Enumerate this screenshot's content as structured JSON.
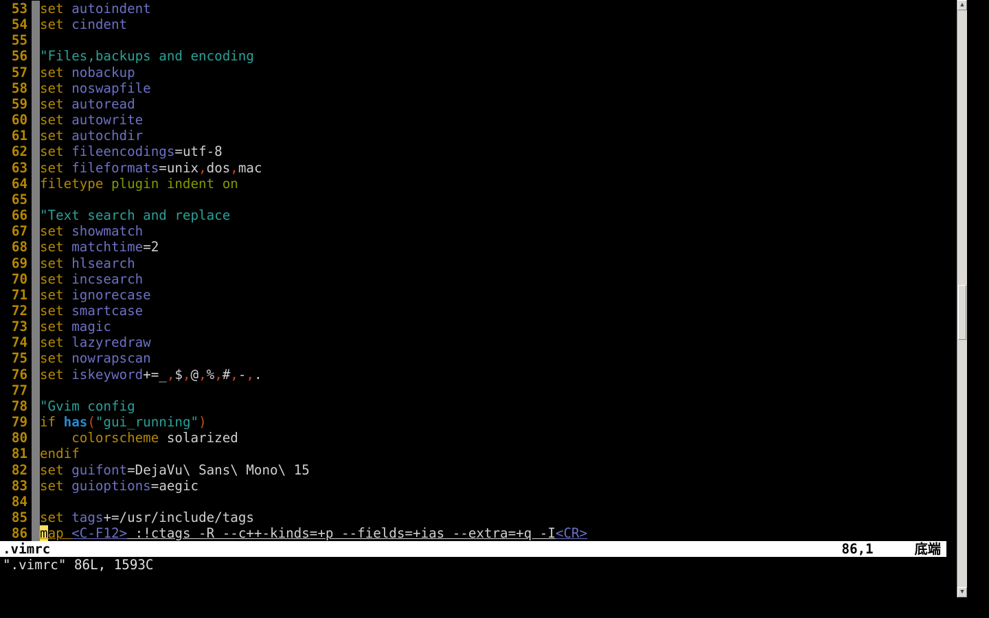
{
  "status": {
    "filename": ".vimrc",
    "position": "86,1",
    "percent": "底端"
  },
  "message": "\".vimrc\" 86L, 1593C",
  "lines": [
    {
      "n": 53,
      "t": [
        [
          "kw-set",
          "set "
        ],
        [
          "opt",
          "autoindent"
        ]
      ]
    },
    {
      "n": 54,
      "t": [
        [
          "kw-set",
          "set "
        ],
        [
          "opt",
          "cindent"
        ]
      ]
    },
    {
      "n": 55,
      "t": []
    },
    {
      "n": 56,
      "t": [
        [
          "comment",
          "\"Files,backups and encoding"
        ]
      ]
    },
    {
      "n": 57,
      "t": [
        [
          "kw-set",
          "set "
        ],
        [
          "opt",
          "nobackup"
        ]
      ]
    },
    {
      "n": 58,
      "t": [
        [
          "kw-set",
          "set "
        ],
        [
          "opt",
          "noswapfile"
        ]
      ]
    },
    {
      "n": 59,
      "t": [
        [
          "kw-set",
          "set "
        ],
        [
          "opt",
          "autoread"
        ]
      ]
    },
    {
      "n": 60,
      "t": [
        [
          "kw-set",
          "set "
        ],
        [
          "opt",
          "autowrite"
        ]
      ]
    },
    {
      "n": 61,
      "t": [
        [
          "kw-set",
          "set "
        ],
        [
          "opt",
          "autochdir"
        ]
      ]
    },
    {
      "n": 62,
      "t": [
        [
          "kw-set",
          "set "
        ],
        [
          "opt",
          "fileencodings"
        ],
        [
          "eq",
          "="
        ],
        [
          "plain",
          "utf-8"
        ]
      ]
    },
    {
      "n": 63,
      "t": [
        [
          "kw-set",
          "set "
        ],
        [
          "opt",
          "fileformats"
        ],
        [
          "eq",
          "="
        ],
        [
          "plain",
          "unix"
        ],
        [
          "punct",
          ","
        ],
        [
          "plain",
          "dos"
        ],
        [
          "punct",
          ","
        ],
        [
          "plain",
          "mac"
        ]
      ]
    },
    {
      "n": 64,
      "t": [
        [
          "kw-yellow",
          "filetype "
        ],
        [
          "ident-green",
          "plugin indent on"
        ]
      ]
    },
    {
      "n": 65,
      "t": []
    },
    {
      "n": 66,
      "t": [
        [
          "comment",
          "\"Text search and replace"
        ]
      ]
    },
    {
      "n": 67,
      "t": [
        [
          "kw-set",
          "set "
        ],
        [
          "opt",
          "showmatch"
        ]
      ]
    },
    {
      "n": 68,
      "t": [
        [
          "kw-set",
          "set "
        ],
        [
          "opt",
          "matchtime"
        ],
        [
          "eq",
          "="
        ],
        [
          "plain",
          "2"
        ]
      ]
    },
    {
      "n": 69,
      "t": [
        [
          "kw-set",
          "set "
        ],
        [
          "opt",
          "hlsearch"
        ]
      ]
    },
    {
      "n": 70,
      "t": [
        [
          "kw-set",
          "set "
        ],
        [
          "opt",
          "incsearch"
        ]
      ]
    },
    {
      "n": 71,
      "t": [
        [
          "kw-set",
          "set "
        ],
        [
          "opt",
          "ignorecase"
        ]
      ]
    },
    {
      "n": 72,
      "t": [
        [
          "kw-set",
          "set "
        ],
        [
          "opt",
          "smartcase"
        ]
      ]
    },
    {
      "n": 73,
      "t": [
        [
          "kw-set",
          "set "
        ],
        [
          "opt",
          "magic"
        ]
      ]
    },
    {
      "n": 74,
      "t": [
        [
          "kw-set",
          "set "
        ],
        [
          "opt",
          "lazyredraw"
        ]
      ]
    },
    {
      "n": 75,
      "t": [
        [
          "kw-set",
          "set "
        ],
        [
          "opt",
          "nowrapscan"
        ]
      ]
    },
    {
      "n": 76,
      "t": [
        [
          "kw-set",
          "set "
        ],
        [
          "opt",
          "iskeyword"
        ],
        [
          "eq",
          "+="
        ],
        [
          "plain",
          "_"
        ],
        [
          "punct",
          ","
        ],
        [
          "plain",
          "$"
        ],
        [
          "punct",
          ","
        ],
        [
          "plain",
          "@"
        ],
        [
          "punct",
          ","
        ],
        [
          "plain",
          "%"
        ],
        [
          "punct",
          ","
        ],
        [
          "plain",
          "#"
        ],
        [
          "punct",
          ","
        ],
        [
          "plain",
          "-"
        ],
        [
          "punct",
          ","
        ],
        [
          "plain",
          "."
        ]
      ]
    },
    {
      "n": 77,
      "t": []
    },
    {
      "n": 78,
      "t": [
        [
          "comment",
          "\"Gvim config"
        ]
      ]
    },
    {
      "n": 79,
      "t": [
        [
          "kw-yellow",
          "if "
        ],
        [
          "func",
          "has"
        ],
        [
          "punct",
          "("
        ],
        [
          "str",
          "\"gui_running\""
        ],
        [
          "punct",
          ")"
        ]
      ]
    },
    {
      "n": 80,
      "t": [
        [
          "plain",
          "    "
        ],
        [
          "kw-yellow",
          "colorscheme "
        ],
        [
          "plain",
          "solarized"
        ]
      ]
    },
    {
      "n": 81,
      "t": [
        [
          "kw-yellow",
          "endif"
        ]
      ]
    },
    {
      "n": 82,
      "t": [
        [
          "kw-set",
          "set "
        ],
        [
          "opt",
          "guifont"
        ],
        [
          "eq",
          "="
        ],
        [
          "plain",
          "DejaVu\\ Sans\\ Mono\\ 15"
        ]
      ]
    },
    {
      "n": 83,
      "t": [
        [
          "kw-set",
          "set "
        ],
        [
          "opt",
          "guioptions"
        ],
        [
          "eq",
          "="
        ],
        [
          "plain",
          "aegic"
        ]
      ]
    },
    {
      "n": 84,
      "t": []
    },
    {
      "n": 85,
      "t": [
        [
          "kw-set",
          "set "
        ],
        [
          "opt",
          "tags"
        ],
        [
          "eq",
          "+="
        ],
        [
          "plain",
          "/usr/include/tags"
        ]
      ]
    },
    {
      "n": 86,
      "cursor": true,
      "u": true,
      "t": [
        [
          "kw-yellow",
          "map "
        ],
        [
          "mapkey",
          "<C-F12>"
        ],
        [
          "plain",
          " :!ctags -R --c++-kinds=+p --fields=+ias --extra=+q -I"
        ],
        [
          "mapkey",
          "<CR>"
        ]
      ]
    }
  ]
}
